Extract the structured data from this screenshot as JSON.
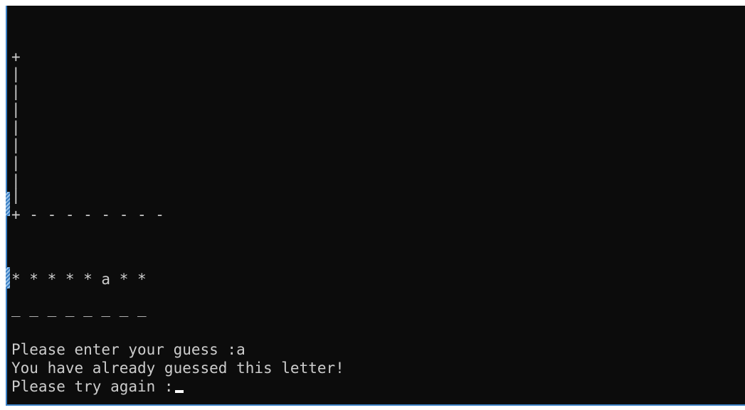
{
  "console": {
    "gallows": {
      "top": "+",
      "poles": [
        "|",
        "|",
        "|",
        "|",
        "|",
        "|",
        "|",
        "|"
      ],
      "base": "+ - - - - - - - -"
    },
    "word_mask": "* * * * * a * *",
    "underline": "_ _ _ _ _ _ _ _",
    "prompt_guess": "Please enter your guess :a",
    "message_already": "You have already guessed this letter!",
    "prompt_retry": "Please try again :"
  }
}
